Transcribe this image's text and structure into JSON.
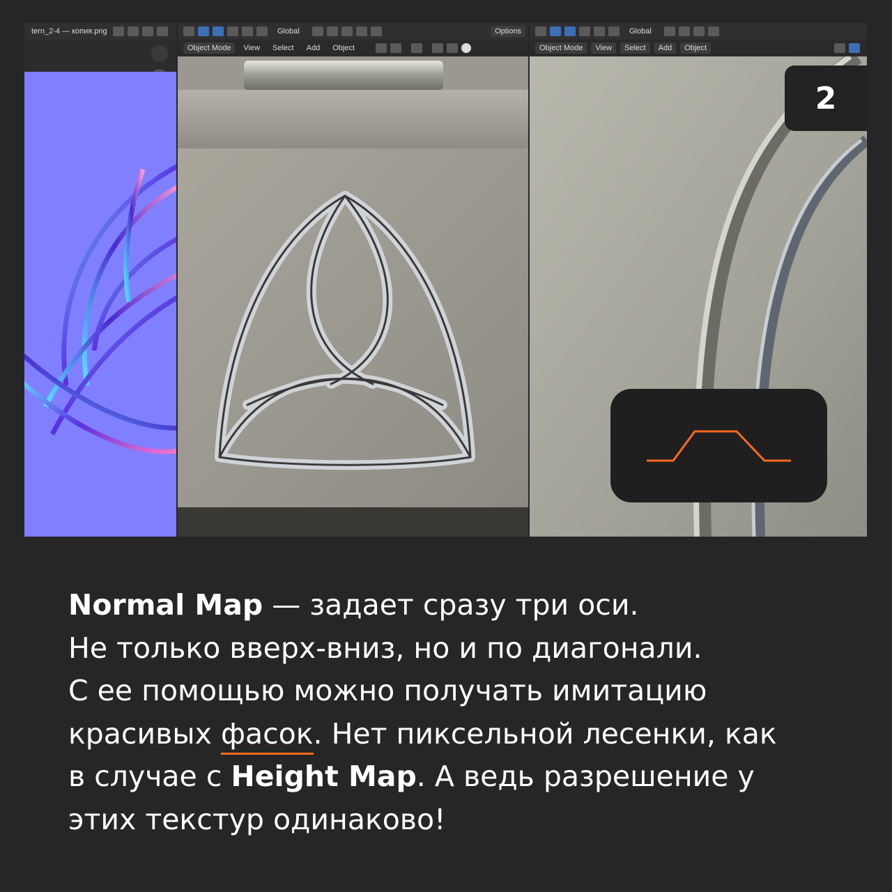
{
  "slide_number": "2",
  "image_editor": {
    "file_tab": "tern_2-4 — копия.png"
  },
  "viewport_middle": {
    "transform": "Global",
    "options": "Options",
    "mode": "Object Mode",
    "menu": [
      "View",
      "Select",
      "Add",
      "Object"
    ]
  },
  "viewport_right": {
    "transform": "Global",
    "mode": "Object Mode",
    "menu": [
      "View",
      "Select",
      "Add",
      "Object"
    ]
  },
  "colors": {
    "background": "#262626",
    "accent": "#ff6a1f",
    "normal_map_base": "#8080ff"
  },
  "caption": {
    "line1_bold": "Normal Map",
    "line1_rest": " — задает сразу три оси.",
    "line2": "Не только вверх-вниз, но и по диагонали.",
    "line3": "С ее помощью можно получать имитацию",
    "line4_pre": "красивых ",
    "line4_underlined": "фасок",
    "line4_post": ". Нет пиксельной лесенки, как",
    "line5_pre": "в случае с ",
    "line5_bold": "Height Map",
    "line5_post": ". А ведь разрешение у",
    "line6": "этих текстур одинаково!"
  }
}
